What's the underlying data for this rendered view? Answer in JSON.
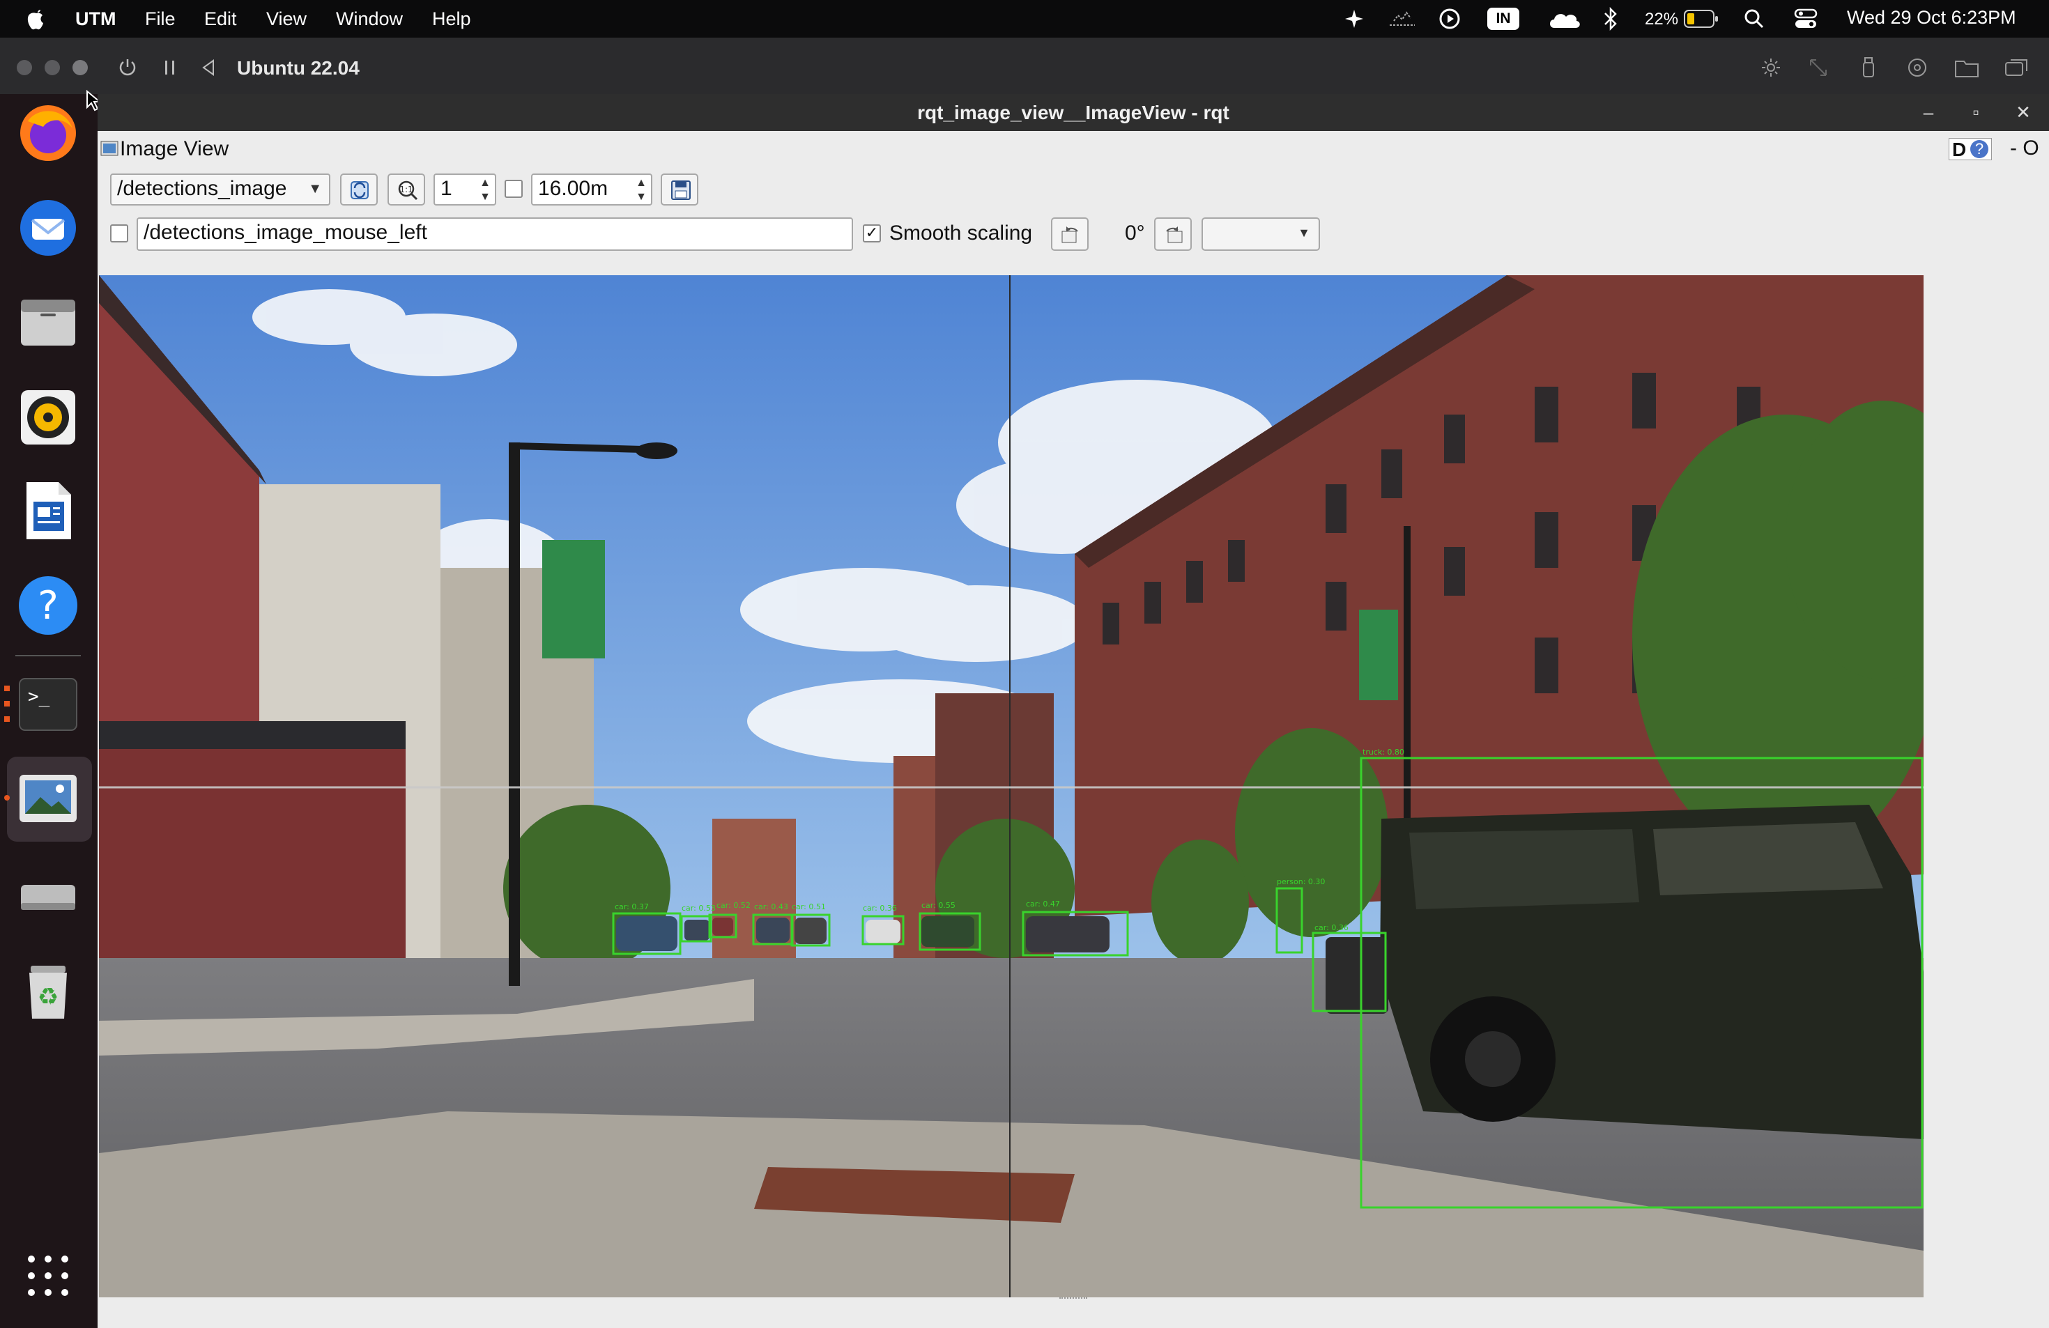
{
  "menubar": {
    "app": "UTM",
    "items": [
      "File",
      "Edit",
      "View",
      "Window",
      "Help"
    ],
    "keyboard": "IN",
    "battery": "22%",
    "datetime": "Wed 29 Oct  6:23PM"
  },
  "utm": {
    "vm_name": "Ubuntu 22.04"
  },
  "window": {
    "title": "rqt_image_view__ImageView - rqt"
  },
  "plugin": {
    "title": "Image View",
    "d_label": "D",
    "help_glyph": "?",
    "extra": "- O"
  },
  "toolbar": {
    "topic": "/detections_image",
    "zoom_value": "1",
    "rate_value": "16.00m",
    "mouse_topic": "/detections_image_mouse_left",
    "smooth_label": "Smooth scaling",
    "smooth_checked": true,
    "rotation": "0°"
  },
  "detections": [
    {
      "label": "truck: 0.80"
    },
    {
      "label": "car: 0.37"
    },
    {
      "label": "car: 0.53"
    },
    {
      "label": "car: 0.52"
    },
    {
      "label": "car: 0.43"
    },
    {
      "label": "car: 0.51"
    },
    {
      "label": "car: 0.36"
    },
    {
      "label": "car: 0.55"
    },
    {
      "label": "car: 0.47"
    },
    {
      "label": "person: 0.30"
    },
    {
      "label": "car: 0.36"
    }
  ],
  "colors": {
    "detection_box": "#39d32c",
    "menubar_bg": "#0b0b0c",
    "window_bg": "#ececec"
  }
}
